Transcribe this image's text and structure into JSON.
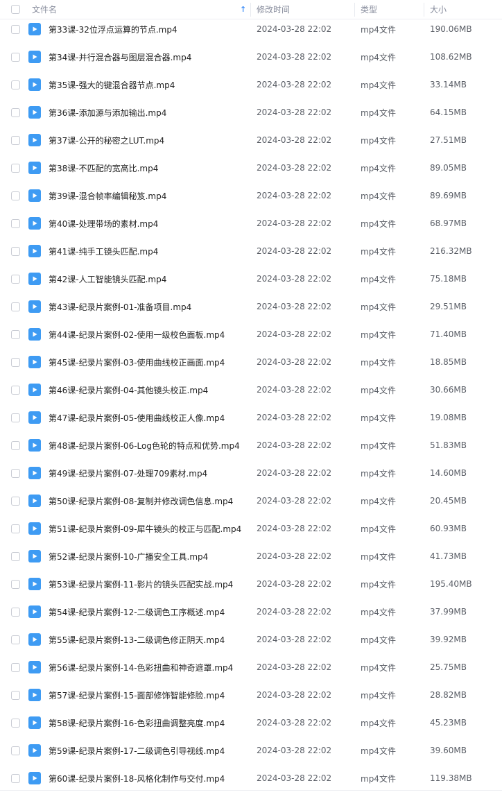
{
  "header": {
    "name_label": "文件名",
    "modified_label": "修改时间",
    "type_label": "类型",
    "size_label": "大小",
    "sort_indicator": "↑"
  },
  "files": [
    {
      "name": "第33课-32位浮点运算的节点.mp4",
      "modified": "2024-03-28 22:02",
      "type": "mp4文件",
      "size": "190.06MB"
    },
    {
      "name": "第34课-并行混合器与图层混合器.mp4",
      "modified": "2024-03-28 22:02",
      "type": "mp4文件",
      "size": "108.62MB"
    },
    {
      "name": "第35课-强大的键混合器节点.mp4",
      "modified": "2024-03-28 22:02",
      "type": "mp4文件",
      "size": "33.14MB"
    },
    {
      "name": "第36课-添加源与添加输出.mp4",
      "modified": "2024-03-28 22:02",
      "type": "mp4文件",
      "size": "64.15MB"
    },
    {
      "name": "第37课-公开的秘密之LUT.mp4",
      "modified": "2024-03-28 22:02",
      "type": "mp4文件",
      "size": "27.51MB"
    },
    {
      "name": "第38课-不匹配的宽高比.mp4",
      "modified": "2024-03-28 22:02",
      "type": "mp4文件",
      "size": "89.05MB"
    },
    {
      "name": "第39课-混合帧率编辑秘笈.mp4",
      "modified": "2024-03-28 22:02",
      "type": "mp4文件",
      "size": "89.69MB"
    },
    {
      "name": "第40课-处理带场的素材.mp4",
      "modified": "2024-03-28 22:02",
      "type": "mp4文件",
      "size": "68.97MB"
    },
    {
      "name": "第41课-纯手工镜头匹配.mp4",
      "modified": "2024-03-28 22:02",
      "type": "mp4文件",
      "size": "216.32MB"
    },
    {
      "name": "第42课-人工智能镜头匹配.mp4",
      "modified": "2024-03-28 22:02",
      "type": "mp4文件",
      "size": "75.18MB"
    },
    {
      "name": "第43课-纪录片案例-01-准备项目.mp4",
      "modified": "2024-03-28 22:02",
      "type": "mp4文件",
      "size": "29.51MB"
    },
    {
      "name": "第44课-纪录片案例-02-使用一级校色面板.mp4",
      "modified": "2024-03-28 22:02",
      "type": "mp4文件",
      "size": "71.40MB"
    },
    {
      "name": "第45课-纪录片案例-03-使用曲线校正画面.mp4",
      "modified": "2024-03-28 22:02",
      "type": "mp4文件",
      "size": "18.85MB"
    },
    {
      "name": "第46课-纪录片案例-04-其他镜头校正.mp4",
      "modified": "2024-03-28 22:02",
      "type": "mp4文件",
      "size": "30.66MB"
    },
    {
      "name": "第47课-纪录片案例-05-使用曲线校正人像.mp4",
      "modified": "2024-03-28 22:02",
      "type": "mp4文件",
      "size": "19.08MB"
    },
    {
      "name": "第48课-纪录片案例-06-Log色轮的特点和优势.mp4",
      "modified": "2024-03-28 22:02",
      "type": "mp4文件",
      "size": "51.83MB"
    },
    {
      "name": "第49课-纪录片案例-07-处理709素材.mp4",
      "modified": "2024-03-28 22:02",
      "type": "mp4文件",
      "size": "14.60MB"
    },
    {
      "name": "第50课-纪录片案例-08-复制并修改调色信息.mp4",
      "modified": "2024-03-28 22:02",
      "type": "mp4文件",
      "size": "20.45MB"
    },
    {
      "name": "第51课-纪录片案例-09-犀牛镜头的校正与匹配.mp4",
      "modified": "2024-03-28 22:02",
      "type": "mp4文件",
      "size": "60.93MB"
    },
    {
      "name": "第52课-纪录片案例-10-广播安全工具.mp4",
      "modified": "2024-03-28 22:02",
      "type": "mp4文件",
      "size": "41.73MB"
    },
    {
      "name": "第53课-纪录片案例-11-影片的镜头匹配实战.mp4",
      "modified": "2024-03-28 22:02",
      "type": "mp4文件",
      "size": "195.40MB"
    },
    {
      "name": "第54课-纪录片案例-12-二级调色工序概述.mp4",
      "modified": "2024-03-28 22:02",
      "type": "mp4文件",
      "size": "37.99MB"
    },
    {
      "name": "第55课-纪录片案例-13-二级调色修正阴天.mp4",
      "modified": "2024-03-28 22:02",
      "type": "mp4文件",
      "size": "39.92MB"
    },
    {
      "name": "第56课-纪录片案例-14-色彩扭曲和神奇遮罩.mp4",
      "modified": "2024-03-28 22:02",
      "type": "mp4文件",
      "size": "25.75MB"
    },
    {
      "name": "第57课-纪录片案例-15-面部修饰智能修脸.mp4",
      "modified": "2024-03-28 22:02",
      "type": "mp4文件",
      "size": "28.82MB"
    },
    {
      "name": "第58课-纪录片案例-16-色彩扭曲调整亮度.mp4",
      "modified": "2024-03-28 22:02",
      "type": "mp4文件",
      "size": "45.23MB"
    },
    {
      "name": "第59课-纪录片案例-17-二级调色引导视线.mp4",
      "modified": "2024-03-28 22:02",
      "type": "mp4文件",
      "size": "39.60MB"
    },
    {
      "name": "第60课-纪录片案例-18-风格化制作与交付.mp4",
      "modified": "2024-03-28 22:02",
      "type": "mp4文件",
      "size": "119.38MB"
    }
  ],
  "icons": {
    "file_icon": "video-file-icon",
    "checkbox": "checkbox-icon"
  },
  "colors": {
    "accent": "#3e8ef7",
    "file_icon": "#3e9bf3"
  }
}
